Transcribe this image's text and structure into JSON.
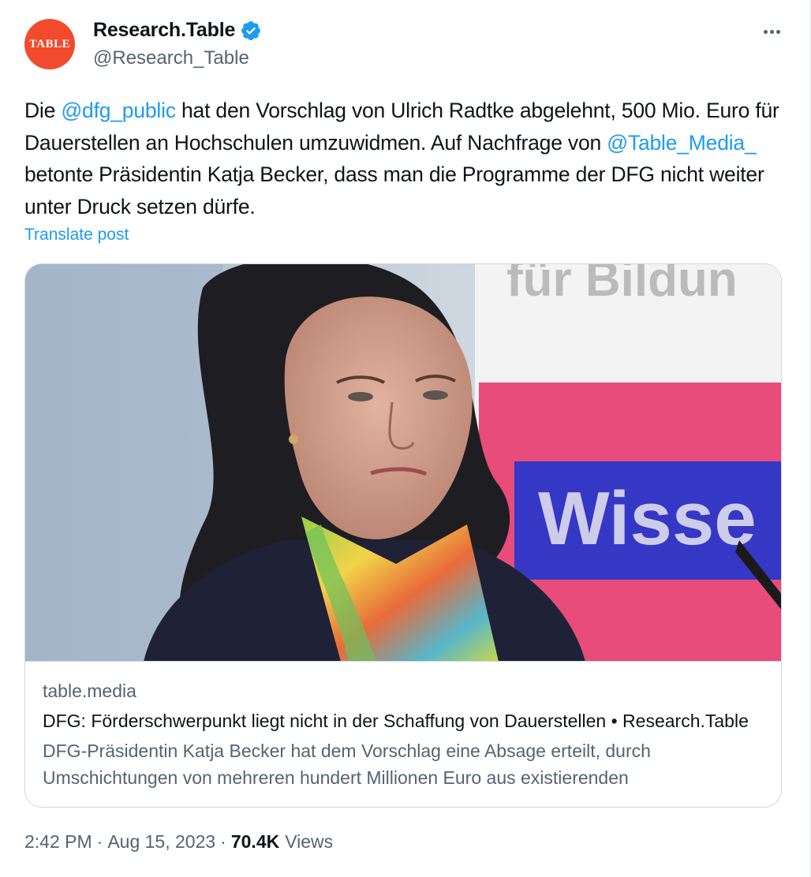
{
  "author": {
    "display_name": "Research.Table",
    "handle": "@Research_Table",
    "avatar_text": "TABLE",
    "verified_icon": "verified-badge-icon"
  },
  "tweet": {
    "text_segments": [
      {
        "text": "Die ",
        "type": "text"
      },
      {
        "text": "@dfg_public",
        "type": "mention"
      },
      {
        "text": " hat den Vorschlag von Ulrich Radtke abgelehnt, 500 Mio. Euro für Dauerstellen an Hochschulen umzuwidmen. Auf Nachfrage von ",
        "type": "text"
      },
      {
        "text": "@Table_Media_",
        "type": "mention"
      },
      {
        "text": " betonte Präsidentin Katja Becker, dass man die Programme der DFG nicht weiter unter Druck setzen dürfe.",
        "type": "text"
      }
    ],
    "translate_label": "Translate post"
  },
  "card": {
    "image_text": "Wisse",
    "image_top_text": "für Bildun",
    "domain": "table.media",
    "title": "DFG: Förderschwerpunkt liegt nicht in der Schaffung von Dauerstellen • Research.Table",
    "description": "DFG-Präsidentin Katja Becker hat dem Vorschlag eine Absage erteilt, durch Umschichtungen von mehreren hundert Millionen Euro aus existierenden"
  },
  "meta": {
    "time": "2:42 PM",
    "separator": "·",
    "date": "Aug 15, 2023",
    "views_count": "70.4K",
    "views_label": "Views"
  },
  "colors": {
    "accent": "#1d9bf0",
    "secondary_text": "#536471",
    "avatar_bg": "#f24a2c"
  }
}
